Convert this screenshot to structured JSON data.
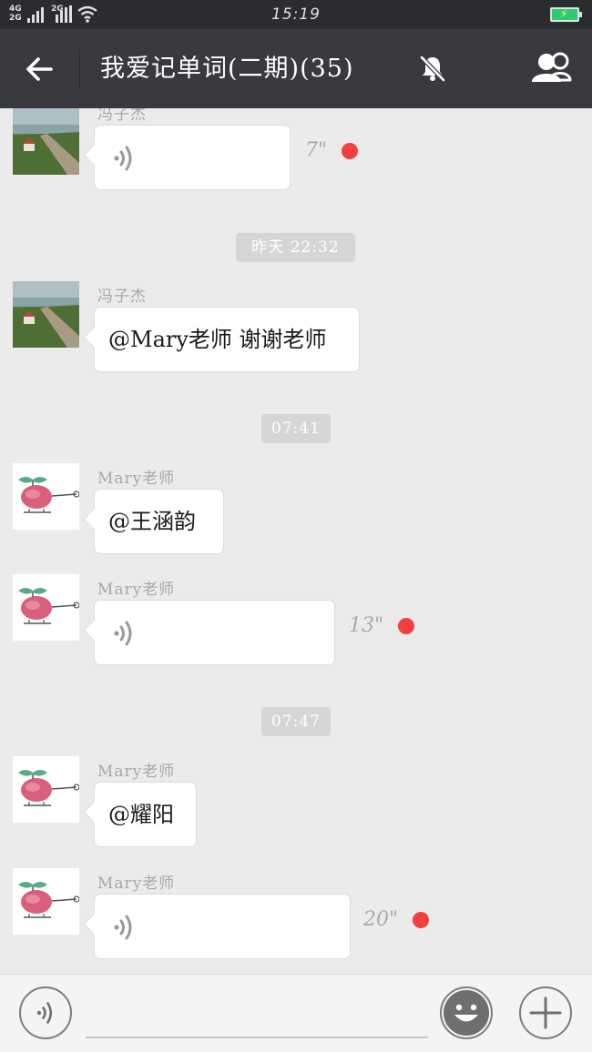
{
  "status_bar": {
    "network_1": "4G",
    "network_2": "2G",
    "network_3": "2G",
    "time": "15:19",
    "battery_color": "#2ecc71"
  },
  "header": {
    "title": "我爱记单词(二期)(35)",
    "back_icon": "arrow-left-icon",
    "mute_icon": "bell-off-icon",
    "members_icon": "group-members-icon"
  },
  "messages": [
    {
      "type": "voice",
      "sender": "冯子杰",
      "avatar": "landscape",
      "duration": "7\"",
      "unread": true
    },
    {
      "type": "timestamp",
      "text": "昨天 22:32"
    },
    {
      "type": "text",
      "sender": "冯子杰",
      "avatar": "landscape",
      "text": "@Mary老师 谢谢老师"
    },
    {
      "type": "timestamp",
      "text": "07:41"
    },
    {
      "type": "text",
      "sender": "Mary老师",
      "avatar": "helicopter",
      "text": "@王涵韵"
    },
    {
      "type": "voice",
      "sender": "Mary老师",
      "avatar": "helicopter",
      "duration": "13\"",
      "unread": true
    },
    {
      "type": "timestamp",
      "text": "07:47"
    },
    {
      "type": "text",
      "sender": "Mary老师",
      "avatar": "helicopter",
      "text": "@耀阳"
    },
    {
      "type": "voice",
      "sender": "Mary老师",
      "avatar": "helicopter",
      "duration": "20\"",
      "unread": true
    }
  ],
  "input_bar": {
    "voice_icon": "voice-mode-icon",
    "input_value": "",
    "emoji_icon": "smiley-icon",
    "plus_icon": "plus-icon"
  },
  "colors": {
    "header_bg": "#393a3f",
    "chat_bg": "#ebebeb",
    "unread_dot": "#f3403f",
    "bubble_bg": "#ffffff"
  }
}
